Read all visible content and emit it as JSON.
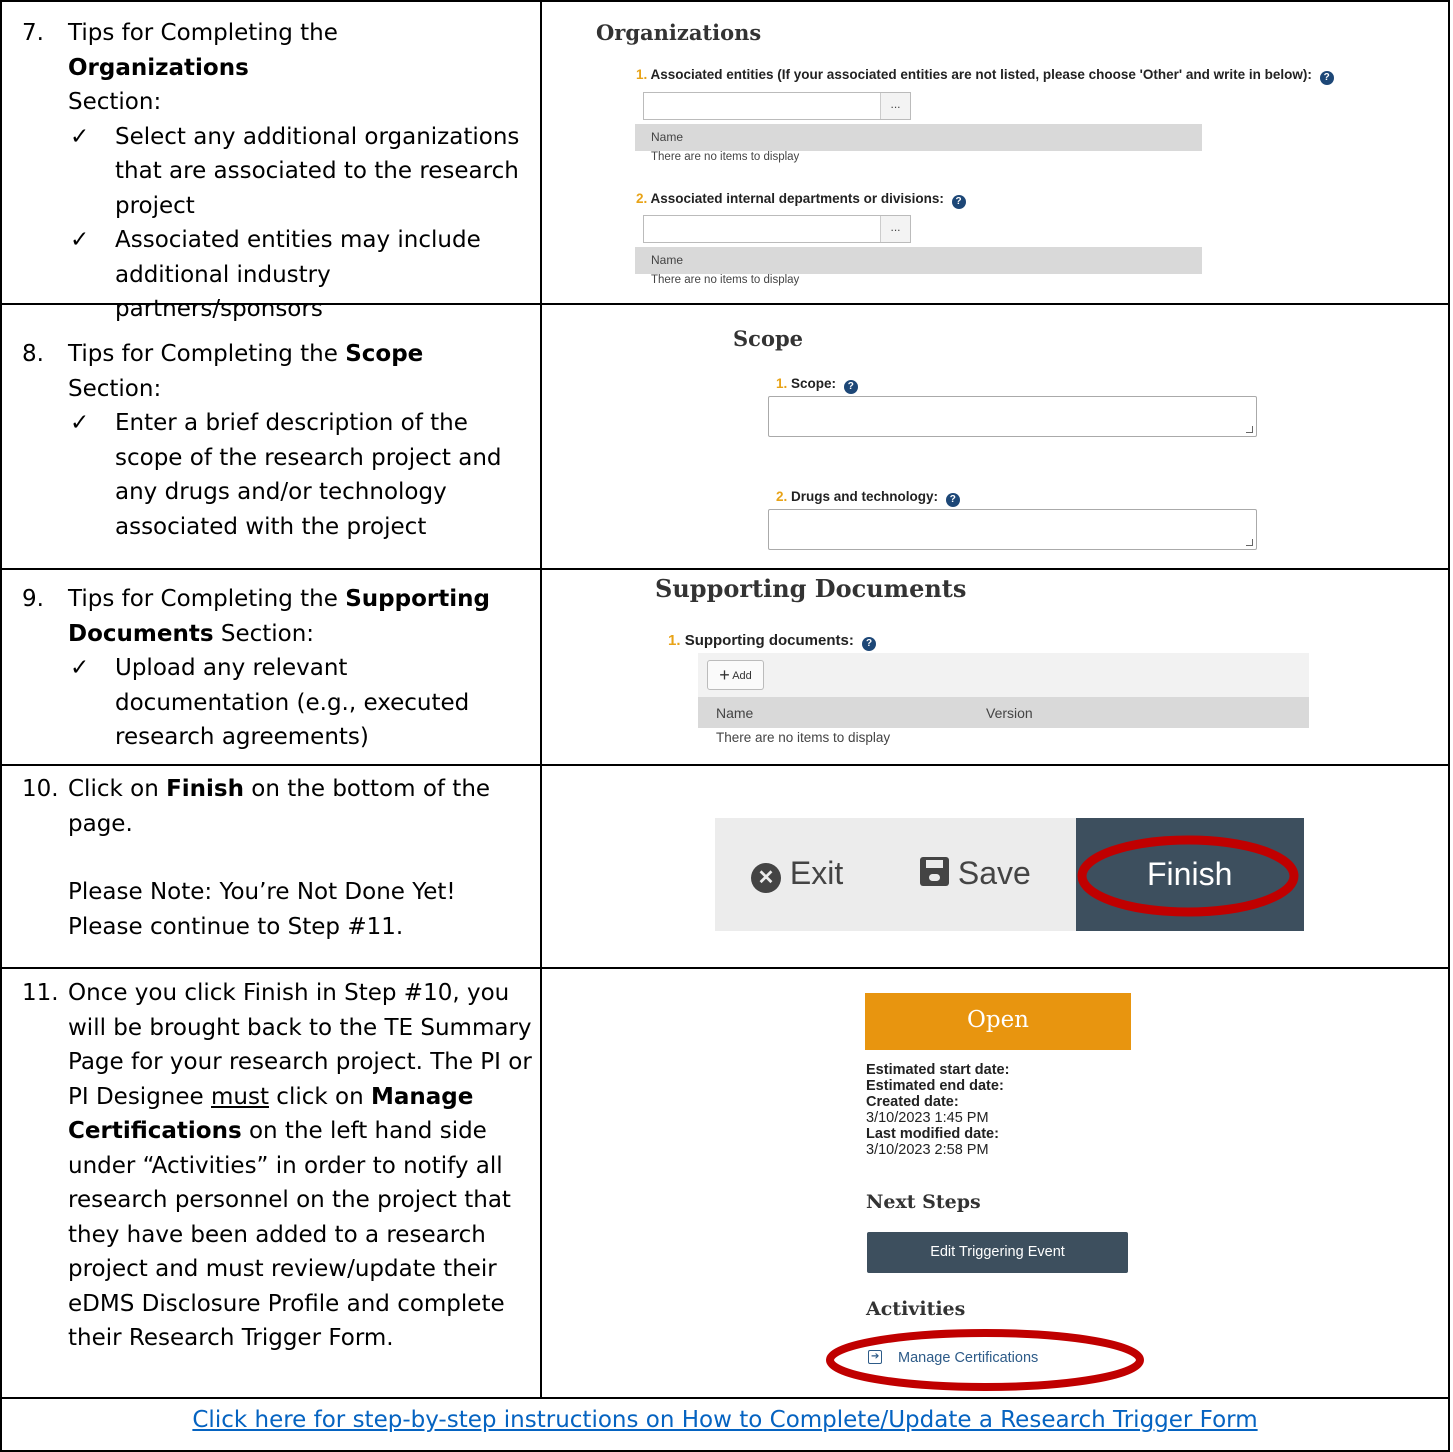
{
  "steps": {
    "s7": {
      "num": "7.",
      "pre": "Tips for Completing the ",
      "bold": "Organizations",
      "post": "Section:",
      "checks": [
        "Select any additional organizations that are associated to the research project",
        "Associated entities may include additional industry partners/sponsors"
      ]
    },
    "s8": {
      "num": "8.",
      "pre": "Tips for Completing the ",
      "bold": "Scope",
      "post": "Section:",
      "checks": [
        "Enter a brief description of the scope of the research project and any drugs and/or technology associated with the project"
      ]
    },
    "s9": {
      "num": "9.",
      "pre": "Tips for Completing the ",
      "bold": "Supporting",
      "bold2": "Documents",
      "post": " Section:",
      "checks": [
        "Upload any relevant documentation (e.g., executed research agreements)"
      ]
    },
    "s10": {
      "num": "10.",
      "pre": "Click on ",
      "bold": "Finish",
      "post": " on the bottom of the page.",
      "note1": "Please Note: You’re Not Done Yet!",
      "note2": "Please continue to Step #11."
    },
    "s11": {
      "num": "11.",
      "t1": "Once you click Finish in Step #10, you will be brought back to the TE Summary Page for your research project. The PI or PI Designee ",
      "underline": "must",
      "t2": " click on ",
      "bold": "Manage Certifications",
      "t3": " on the left hand side under “Activities” in order to notify all research personnel on the project that they have been added to a research project and must review/update their eDMS Disclosure Profile and complete their Research Trigger Form."
    }
  },
  "check_glyph": "✓",
  "organizations": {
    "title": "Organizations",
    "q1_num": "1.",
    "q1_label": "Associated entities (If your associated entities are not listed, please choose 'Other' and write in below):",
    "q2_num": "2.",
    "q2_label": "Associated internal departments or divisions:",
    "chooser_btn": "...",
    "col_name": "Name",
    "empty": "There are no items to display"
  },
  "scope": {
    "title": "Scope",
    "q1_num": "1.",
    "q1_label": "Scope:",
    "q2_num": "2.",
    "q2_label": "Drugs and technology:"
  },
  "supporting": {
    "title": "Supporting Documents",
    "q1_num": "1.",
    "q1_label": "Supporting documents:",
    "add_label": "Add",
    "col_name": "Name",
    "col_version": "Version",
    "empty": "There are no items to display"
  },
  "finish_bar": {
    "exit_label": "Exit",
    "save_label": "Save",
    "finish_label": "Finish",
    "bar_color": "#ececec",
    "finish_color": "#3d4f5e",
    "highlight_color": "#c00000"
  },
  "summary": {
    "status": "Open",
    "status_color": "#e8950f",
    "start_label": "Estimated start date:",
    "end_label": "Estimated end date:",
    "created_label": "Created date:",
    "created_value": "3/10/2023 1:45 PM",
    "modified_label": "Last modified date:",
    "modified_value": "3/10/2023 2:58 PM",
    "next_steps": "Next Steps",
    "edit_button": "Edit Triggering Event",
    "activities": "Activities",
    "manage_cert": "Manage Certifications"
  },
  "footer_link": "Click here for step-by-step instructions on How to Complete/Update a Research Trigger Form"
}
